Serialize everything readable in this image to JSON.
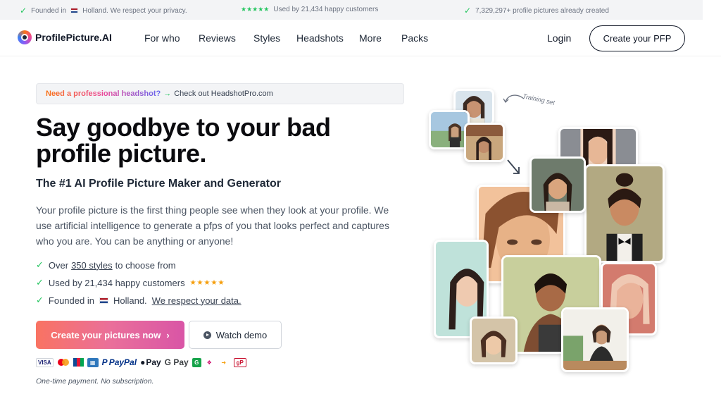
{
  "topbar": {
    "founded_prefix": "Founded in",
    "founded_suffix": "Holland. We respect your privacy.",
    "stars": "★★★★★",
    "used_by": "Used by 21,434 happy customers",
    "created": "7,329,297+ profile pictures already created"
  },
  "nav": {
    "logo": "ProfilePicture.AI",
    "links": [
      "For who",
      "Reviews",
      "Styles",
      "Headshots",
      "More",
      "Packs"
    ],
    "login": "Login",
    "cta": "Create your PFP"
  },
  "hero": {
    "banner_highlight": "Need a professional headshot?",
    "banner_arrow": "→",
    "banner_link": "Check out HeadshotPro.com",
    "title_line1": "Say goodbye to your bad",
    "title_line2": "profile picture.",
    "subtitle": "The #1 AI Profile Picture Maker and Generator",
    "paragraph": "Your profile picture is the first thing people see when they look at your profile. We use artificial intelligence to generate a pfps of you that looks perfect and captures who you are. You can be anything or anyone!",
    "features": {
      "styles_prefix": "Over",
      "styles_link": "350 styles",
      "styles_suffix": "to choose from",
      "customers": "Used by 21,434 happy customers",
      "customers_stars": "★★★★★",
      "founded_prefix": "Founded in",
      "founded_suffix": "Holland.",
      "privacy_link": "We respect your data."
    },
    "primary_button": "Create your pictures now",
    "primary_chevron": "›",
    "secondary_button": "Watch demo",
    "payments": {
      "visa": "VISA",
      "paypal": "PayPal",
      "applepay": "Pay",
      "googlepay": "G Pay",
      "g": "G",
      "gp": "gP"
    },
    "note": "One-time payment. No subscription."
  },
  "collage": {
    "annotation": "Training set"
  },
  "colors": {
    "gradient_start": "#f97362",
    "gradient_end": "#d955a6",
    "check_green": "#22c55e",
    "star_gold": "#f59e0b"
  }
}
